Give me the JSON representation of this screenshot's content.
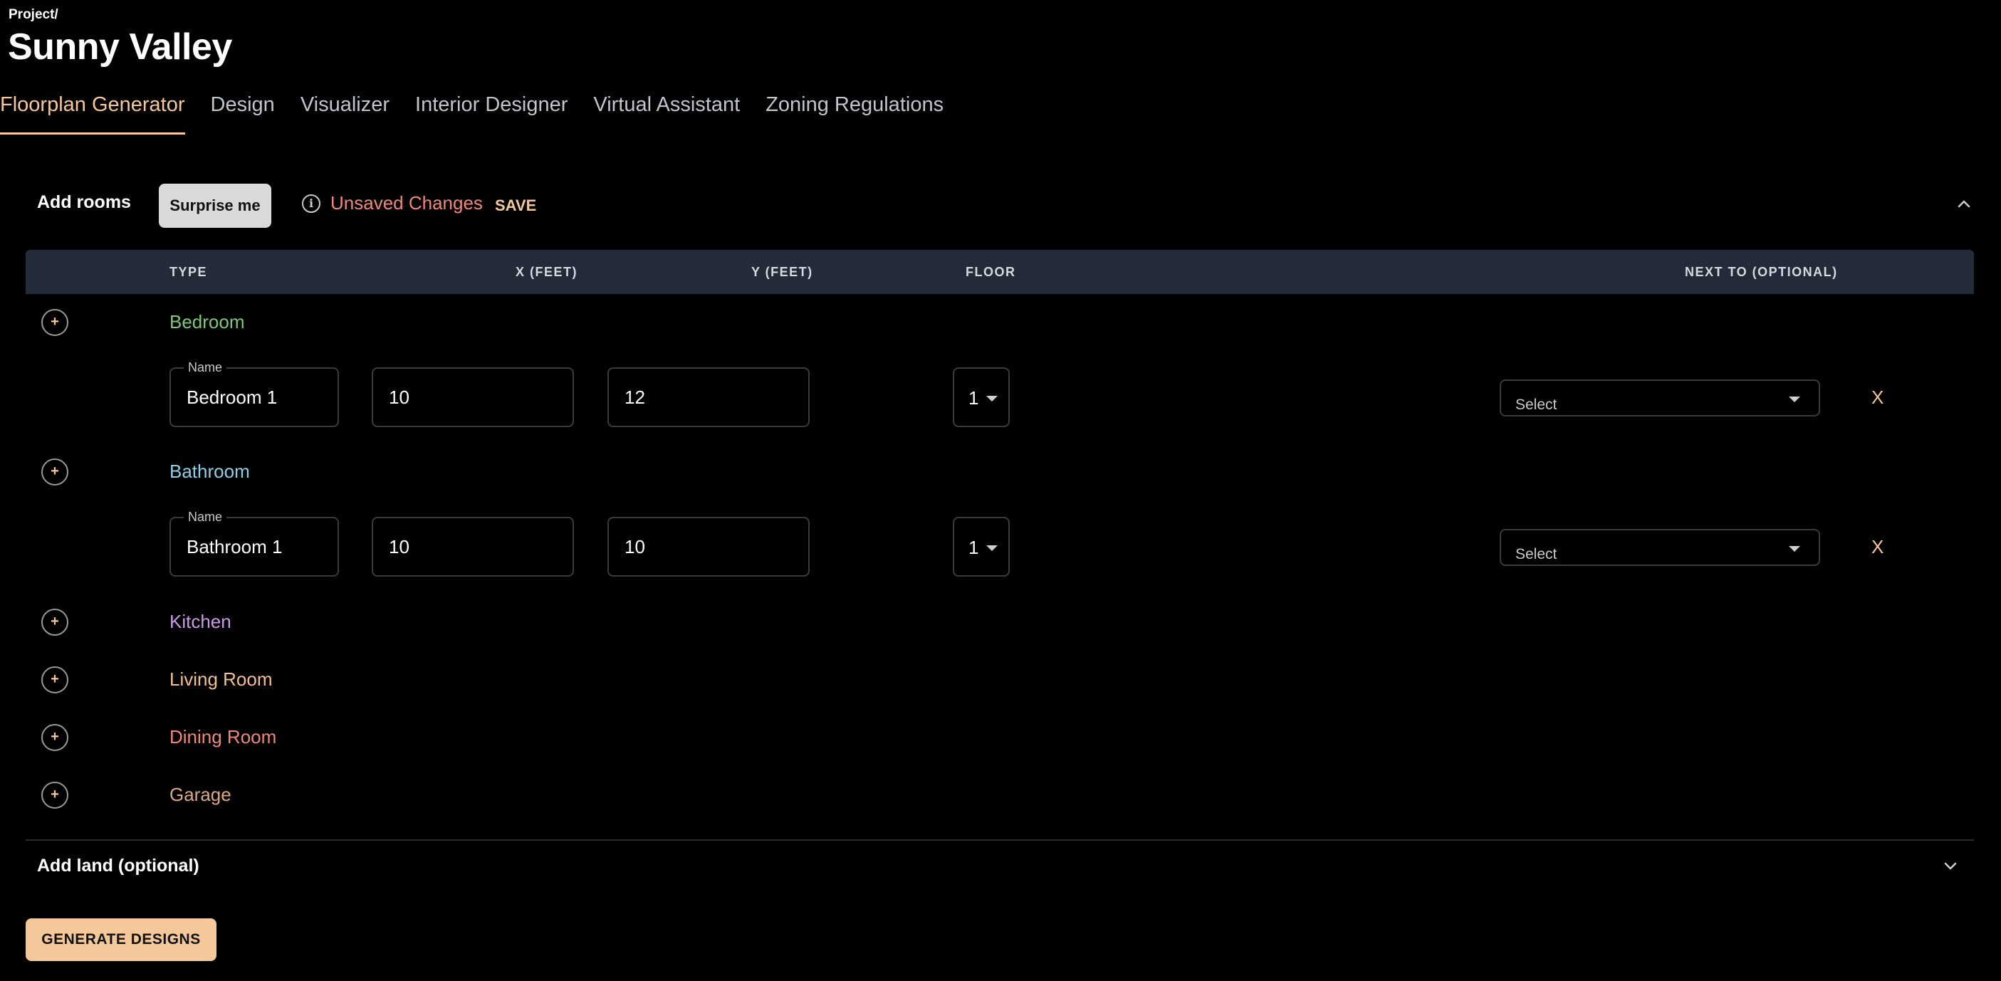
{
  "breadcrumb": "Project/",
  "project_title": "Sunny Valley",
  "tabs": [
    {
      "label": "Floorplan Generator",
      "active": true
    },
    {
      "label": "Design",
      "active": false
    },
    {
      "label": "Visualizer",
      "active": false
    },
    {
      "label": "Interior Designer",
      "active": false
    },
    {
      "label": "Virtual Assistant",
      "active": false
    },
    {
      "label": "Zoning Regulations",
      "active": false
    }
  ],
  "rooms_section": {
    "title": "Add rooms",
    "surprise_label": "Surprise me",
    "unsaved_label": "Unsaved Changes",
    "save_label": "SAVE"
  },
  "table_headers": {
    "type": "TYPE",
    "x": "X (FEET)",
    "y": "Y (FEET)",
    "floor": "FLOOR",
    "next_to": "NEXT TO (OPTIONAL)"
  },
  "room_types": [
    {
      "label": "Bedroom",
      "color": "#7fc77a"
    },
    {
      "label": "Bathroom",
      "color": "#8ccfe6"
    },
    {
      "label": "Kitchen",
      "color": "#c99be8"
    },
    {
      "label": "Living Room",
      "color": "#f2c08a"
    },
    {
      "label": "Dining Room",
      "color": "#f08878"
    },
    {
      "label": "Garage",
      "color": "#d8a982"
    }
  ],
  "room_entries": [
    {
      "name_legend": "Name",
      "name": "Bedroom 1",
      "x": "10",
      "y": "12",
      "floor": "1",
      "next_to_placeholder": "Select",
      "remove_label": "X"
    },
    {
      "name_legend": "Name",
      "name": "Bathroom 1",
      "x": "10",
      "y": "10",
      "floor": "1",
      "next_to_placeholder": "Select",
      "remove_label": "X"
    }
  ],
  "land_section": {
    "title": "Add land (optional)"
  },
  "generate_label": "GENERATE DESIGNS",
  "colors": {
    "accent": "#f4c89a",
    "warning": "#f08878",
    "header_bg": "#232b38",
    "background": "#000000"
  }
}
